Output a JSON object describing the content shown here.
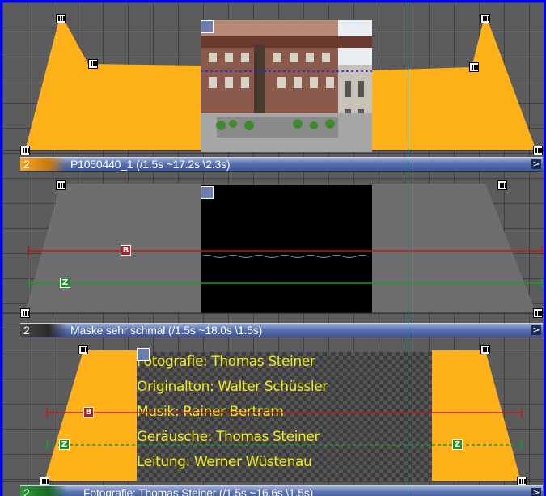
{
  "tracks": [
    {
      "number": "2",
      "title": "P1050440_1 (/1.5s ~17.2s \\2.3s)",
      "badge_color": "#f5a623",
      "envelope_color": "#ffb11a"
    },
    {
      "number": "2",
      "title": "Maske sehr schmal (/1.5s ~18.0s \\1.5s)",
      "badge_color": "#4a4a4a",
      "envelope_color": "#777777"
    },
    {
      "number": "2",
      "title": "Fotografie: Thomas Steiner (/1.5s ~16.6s \\1.5s)",
      "badge_color": "#2e9a3a",
      "envelope_color": "#ffb11a"
    }
  ],
  "keyframe_labels": {
    "red": "B",
    "green": "Z"
  },
  "expand_arrow": ">",
  "credits_lines": [
    "Fotografie: Thomas Steiner",
    "Originalton: Walter Schüssler",
    "Musik: Rainer Bertram",
    "Geräusche: Thomas Steiner",
    "Leitung: Werner Wüstenau"
  ],
  "colors": {
    "frame_border": "#0000ff",
    "timeline_bg": "#5c5c5c",
    "cursor_line": "#5ec8c8",
    "red_line": "#c01818",
    "green_line": "#1c9a2a",
    "credits_text": "#f2ec18"
  }
}
